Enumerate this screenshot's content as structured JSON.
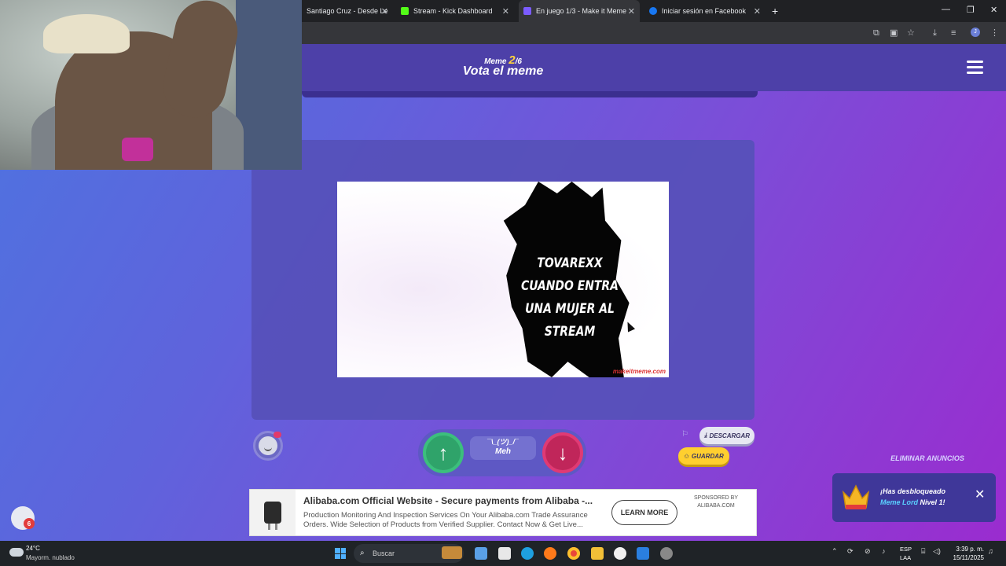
{
  "browser": {
    "tabs": [
      {
        "title": "Santiago Cruz - Desde Le",
        "active": false
      },
      {
        "title": "Stream - Kick Dashboard",
        "active": false
      },
      {
        "title": "En juego 1/3 - Make it Meme",
        "active": true
      },
      {
        "title": "Iniciar sesión en Facebook",
        "active": false
      }
    ],
    "new_tab": "+",
    "close_glyph": "✕"
  },
  "game": {
    "meme_prefix": "Meme",
    "meme_current": "2",
    "meme_total": "/6",
    "title": "Vota el meme",
    "meme_caption": "TOVAREXX CUANDO ENTRA UNA MUJER AL STREAM",
    "watermark": "makeitmeme.com",
    "meh_face": "¯\\_(ツ)_/¯",
    "meh_label": "Meh",
    "download_label": "DESCARGAR",
    "save_label": "GUARDAR",
    "remove_ads": "ELIMINAR ANUNCIOS"
  },
  "toast": {
    "text_prefix": "¡Has desbloqueado ",
    "highlight": "Meme Lord",
    "text_suffix": " Nivel 1!"
  },
  "ad": {
    "title": "Alibaba.com Official Website - Secure payments from Alibaba -...",
    "description": "Production Monitoring And Inspection Services On Your Alibaba.com Trade Assurance Orders. Wide Selection of Products from Verified Supplier. Contact Now & Get Live...",
    "cta": "LEARN MORE",
    "sponsor_line1": "SPONSORED BY",
    "sponsor_line2": "ALIBABA.COM"
  },
  "discord_badge": "6",
  "taskbar": {
    "temp": "24°C",
    "weather": "Mayorm. nublado",
    "search_placeholder": "Buscar",
    "lang_top": "ESP",
    "lang_bottom": "LAA",
    "time": "3:39 p. m.",
    "date": "15/11/2025"
  },
  "colors": {
    "accent_yellow": "#ffd43b",
    "vote_up": "#2fa36a",
    "vote_down": "#c0265a",
    "toast_highlight": "#5ad0ff"
  }
}
